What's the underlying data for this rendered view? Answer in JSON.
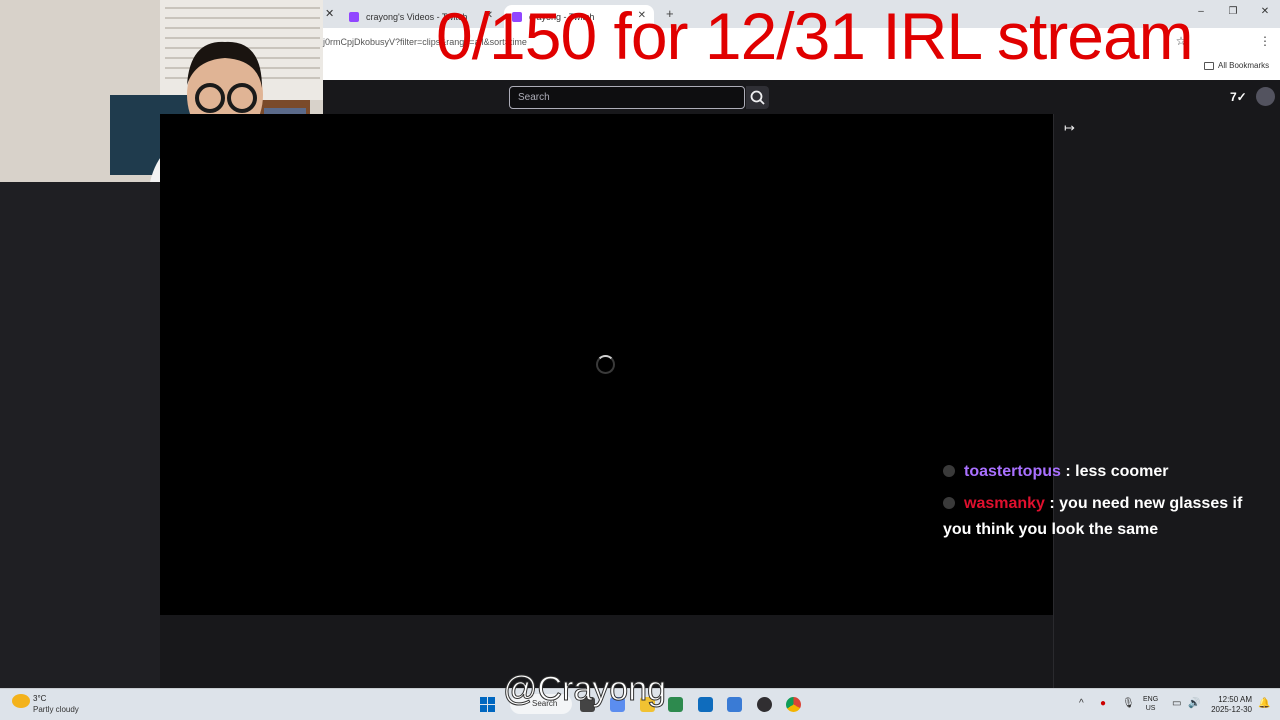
{
  "overlay": {
    "title": "0/150 for 12/31 IRL stream",
    "watermark": "@Crayong"
  },
  "browser": {
    "tabs": [
      {
        "label": "crayong's Videos - Twitch"
      },
      {
        "label": "crayong - Twitch"
      }
    ],
    "url": "j0rmCpjDkobusyV?filter=clips&range=all&sort=time",
    "bookmarks_label": "All Bookmarks"
  },
  "twitch": {
    "search_placeholder": "Search"
  },
  "chat": [
    {
      "user": "toastertopus",
      "color": "#a970ff",
      "message": ": less coomer"
    },
    {
      "user": "wasmanky",
      "color": "#e0102e",
      "message": ": you need new glasses if you think you look the same"
    }
  ],
  "taskbar": {
    "weather_temp": "3°C",
    "weather_desc": "Partly cloudy",
    "search_label": "Search",
    "lang_top": "ENG",
    "lang_bottom": "US",
    "time": "12:50 AM",
    "date": "2025-12-30"
  },
  "colors": {
    "accent_purple": "#9146ff",
    "overlay_red": "#e00000"
  }
}
